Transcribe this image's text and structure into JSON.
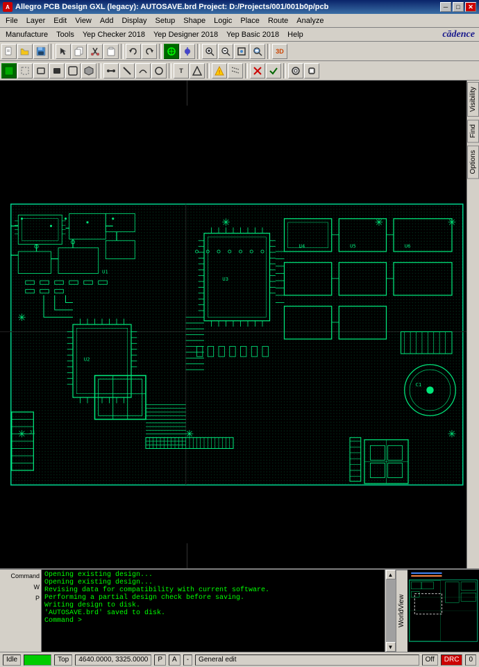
{
  "titlebar": {
    "icon": "A",
    "title": "Allegro PCB Design GXL (legacy): AUTOSAVE.brd  Project: D:/Projects/001/001b0p/pcb",
    "minimize": "─",
    "maximize": "□",
    "close": "✕"
  },
  "menubar1": {
    "items": [
      "File",
      "Layer",
      "Edit",
      "View",
      "Add",
      "Display",
      "Setup",
      "Shape",
      "Logic",
      "Place",
      "Route",
      "Analyze"
    ]
  },
  "menubar2": {
    "items": [
      "Manufacture",
      "Tools",
      "Yep Checker 2018",
      "Yep Designer 2018",
      "Yep Basic 2018",
      "Help"
    ],
    "logo": "cādence"
  },
  "console": {
    "labels": [
      "Command",
      "W",
      "P"
    ],
    "lines": [
      "Opening existing design...",
      "Opening existing design...",
      "Revising data for compatibility with current software.",
      "Performing a partial design check before saving.",
      "Writing design to disk.",
      "'AUTOSAVE.brd' saved to disk.",
      "Command >"
    ]
  },
  "statusbar": {
    "state": "Idle",
    "green_label": "",
    "layer": "Top",
    "coords": "4640.0000, 3325.0000",
    "p_flag": "P",
    "a_flag": "A",
    "separator": "-",
    "mode": "General edit",
    "off_label": "Off",
    "drc_label": "DRC",
    "number": "0"
  },
  "right_panel": {
    "tabs": [
      "Visibility",
      "Find",
      "Options"
    ]
  },
  "worldview": {
    "label": "WorldView"
  },
  "toolbar1": {
    "buttons": [
      "new",
      "open",
      "save",
      "sep",
      "pointer",
      "copy",
      "cut",
      "paste",
      "undo",
      "redo",
      "sep",
      "snap",
      "route",
      "via",
      "sep",
      "zoom-in",
      "zoom-out",
      "zoom-fit",
      "zoom-area",
      "sep",
      "3d"
    ]
  },
  "toolbar2": {
    "buttons": [
      "select",
      "rect",
      "line",
      "arc",
      "circle",
      "sep",
      "mirror",
      "rotate",
      "sep",
      "connect",
      "disconnect",
      "sep",
      "drc",
      "rat",
      "sep",
      "place",
      "route2",
      "via2"
    ]
  }
}
